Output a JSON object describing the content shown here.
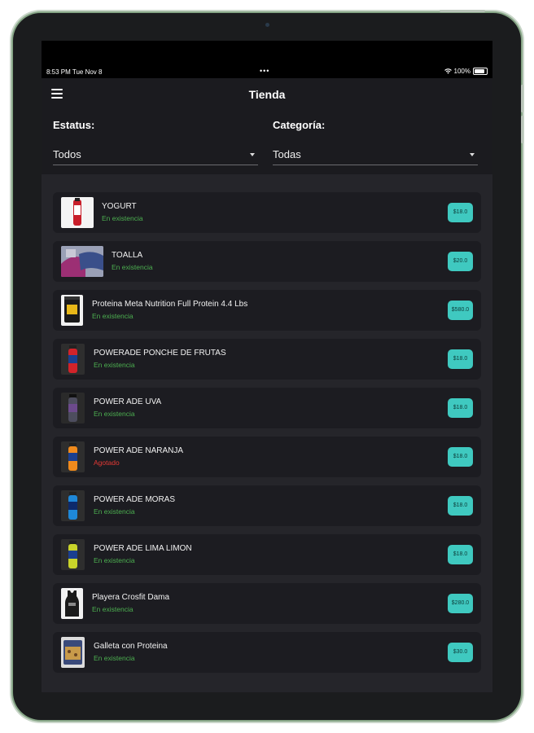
{
  "status_bar": {
    "time": "8:53 PM   Tue Nov 8",
    "dots": "•••",
    "battery": "100%"
  },
  "app": {
    "title": "Tienda"
  },
  "filters": {
    "status": {
      "label": "Estatus:",
      "value": "Todos"
    },
    "category": {
      "label": "Categoría:",
      "value": "Todas"
    }
  },
  "colors": {
    "in_stock": "#4caf50",
    "out_of_stock": "#e53935",
    "price_badge": "#3fc9c0",
    "background": "#25252a"
  },
  "products": [
    {
      "name": "YOGURT",
      "status": "En existencia",
      "price": "$18.0",
      "in_stock": true,
      "image": "yogurt-bottle-icon"
    },
    {
      "name": "TOALLA",
      "status": "En existencia",
      "price": "$20.0",
      "in_stock": true,
      "image": "towel-photo-icon"
    },
    {
      "name": "Proteina Meta Nutrition Full Protein 4.4 Lbs",
      "status": "En existencia",
      "price": "$580.0",
      "in_stock": true,
      "image": "protein-tub-icon"
    },
    {
      "name": "POWERADE PONCHE DE FRUTAS",
      "status": "En existencia",
      "price": "$18.0",
      "in_stock": true,
      "image": "red-bottle-icon"
    },
    {
      "name": "POWER ADE UVA",
      "status": "En existencia",
      "price": "$18.0",
      "in_stock": true,
      "image": "purple-bottle-icon"
    },
    {
      "name": "POWER ADE NARANJA",
      "status": "Agotado",
      "price": "$18.0",
      "in_stock": false,
      "image": "orange-bottle-icon"
    },
    {
      "name": "POWER ADE MORAS",
      "status": "En existencia",
      "price": "$18.0",
      "in_stock": true,
      "image": "blue-bottle-icon"
    },
    {
      "name": "POWER ADE LIMA LIMON",
      "status": "En existencia",
      "price": "$18.0",
      "in_stock": true,
      "image": "yellow-bottle-icon"
    },
    {
      "name": "Playera Crosfit Dama",
      "status": "En existencia",
      "price": "$280.0",
      "in_stock": true,
      "image": "tank-top-icon"
    },
    {
      "name": "Galleta con Proteina",
      "status": "En existencia",
      "price": "$30.0",
      "in_stock": true,
      "image": "cookie-pack-icon"
    }
  ]
}
